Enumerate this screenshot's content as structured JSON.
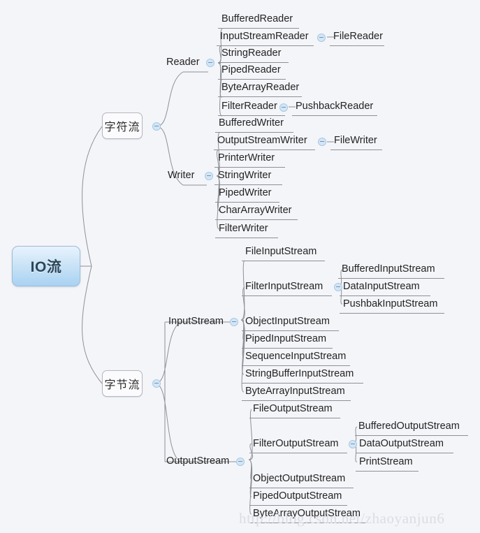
{
  "diagram": {
    "title": "IO流",
    "background_color": "#f4f5f9",
    "root": {
      "label": "IO流",
      "fill_start": "#e8f3fc",
      "fill_end": "#a9d2f2",
      "border": "#9dbdd8"
    },
    "watermark": "http://blog.csdn.net/zhaoyanjun6",
    "icons": {
      "collapse": "minus-circle-icon"
    },
    "branches": [
      {
        "label": "字符流",
        "children": [
          {
            "label": "Reader",
            "collapsible": true,
            "children": [
              {
                "label": "BufferedReader"
              },
              {
                "label": "InputStreamReader",
                "collapsible": true,
                "children": [
                  {
                    "label": "FileReader"
                  }
                ]
              },
              {
                "label": "StringReader"
              },
              {
                "label": "PipedReader"
              },
              {
                "label": "ByteArrayReader"
              },
              {
                "label": "FilterReader",
                "collapsible": true,
                "children": [
                  {
                    "label": "PushbackReader"
                  }
                ]
              }
            ]
          },
          {
            "label": "Writer",
            "collapsible": true,
            "children": [
              {
                "label": "BufferedWriter"
              },
              {
                "label": "OutputStreamWriter",
                "collapsible": true,
                "children": [
                  {
                    "label": "FileWriter"
                  }
                ]
              },
              {
                "label": "PrinterWriter"
              },
              {
                "label": "StringWriter"
              },
              {
                "label": "PipedWriter"
              },
              {
                "label": "CharArrayWriter"
              },
              {
                "label": "FilterWriter"
              }
            ]
          }
        ]
      },
      {
        "label": "字节流",
        "children": [
          {
            "label": "InputStream",
            "collapsible": true,
            "children": [
              {
                "label": "FileInputStream"
              },
              {
                "label": "FilterInputStream",
                "collapsible": true,
                "children": [
                  {
                    "label": "BufferedInputStream"
                  },
                  {
                    "label": "DataInputStream"
                  },
                  {
                    "label": "PushbakInputStream"
                  }
                ]
              },
              {
                "label": "ObjectInputStream"
              },
              {
                "label": "PipedInputStream"
              },
              {
                "label": "SequenceInputStream"
              },
              {
                "label": "StringBufferInputStream"
              },
              {
                "label": "ByteArrayInputStream"
              }
            ]
          },
          {
            "label": "OutputStream",
            "collapsible": true,
            "children": [
              {
                "label": "FileOutputStream"
              },
              {
                "label": "FilterOutputStream",
                "collapsible": true,
                "children": [
                  {
                    "label": "BufferedOutputStream"
                  },
                  {
                    "label": "DataOutputStream"
                  },
                  {
                    "label": "PrintStream"
                  }
                ]
              },
              {
                "label": "ObjectOutputStream"
              },
              {
                "label": "PipedOutputStream"
              },
              {
                "label": "ByteArrayOutputStream"
              }
            ]
          }
        ]
      }
    ]
  },
  "nodes": {
    "root": "IO流",
    "char_stream": "字符流",
    "byte_stream": "字节流",
    "reader": "Reader",
    "reader_1": "BufferedReader",
    "reader_2": "InputStreamReader",
    "reader_2_1": "FileReader",
    "reader_3": "StringReader",
    "reader_4": "PipedReader",
    "reader_5": "ByteArrayReader",
    "reader_6": "FilterReader",
    "reader_6_1": "PushbackReader",
    "writer": "Writer",
    "writer_1": "BufferedWriter",
    "writer_2": "OutputStreamWriter",
    "writer_2_1": "FileWriter",
    "writer_3": "PrinterWriter",
    "writer_4": "StringWriter",
    "writer_5": "PipedWriter",
    "writer_6": "CharArrayWriter",
    "writer_7": "FilterWriter",
    "input_stream": "InputStream",
    "is_1": "FileInputStream",
    "is_2": "FilterInputStream",
    "is_2_1": "BufferedInputStream",
    "is_2_2": "DataInputStream",
    "is_2_3": "PushbakInputStream",
    "is_3": "ObjectInputStream",
    "is_4": "PipedInputStream",
    "is_5": "SequenceInputStream",
    "is_6": "StringBufferInputStream",
    "is_7": "ByteArrayInputStream",
    "output_stream": "OutputStream",
    "os_1": "FileOutputStream",
    "os_2": "FilterOutputStream",
    "os_2_1": "BufferedOutputStream",
    "os_2_2": "DataOutputStream",
    "os_2_3": "PrintStream",
    "os_3": "ObjectOutputStream",
    "os_4": "PipedOutputStream",
    "os_5": "ByteArrayOutputStream"
  },
  "watermark": {
    "text": "http://blog.csdn.net/zhaoyanjun6"
  }
}
